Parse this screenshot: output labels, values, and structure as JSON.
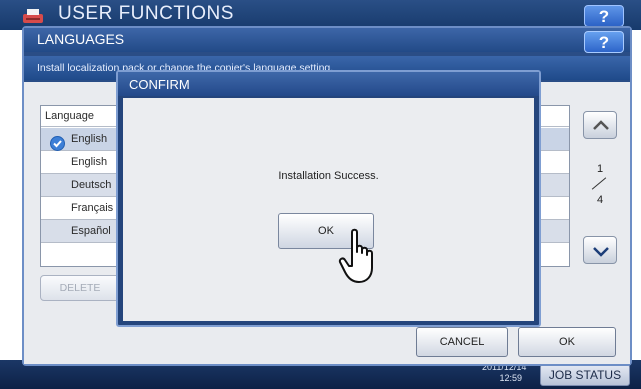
{
  "app": {
    "title": "USER FUNCTIONS",
    "help_label": "?"
  },
  "status_bar": {
    "date": "2011/12/14",
    "time": "12:59",
    "job_status_label": "JOB STATUS"
  },
  "languages_dialog": {
    "title": "LANGUAGES",
    "help_label": "?",
    "description": "Install localization pack or change the copier's language setting.",
    "list_header": "Language",
    "items": [
      {
        "label": "English",
        "selected": true
      },
      {
        "label": "English"
      },
      {
        "label": "Deutsch"
      },
      {
        "label": "Français"
      },
      {
        "label": "Español"
      }
    ],
    "page_current": "1",
    "page_total": "4",
    "delete_label": "DELETE",
    "cancel_label": "CANCEL",
    "ok_label": "OK"
  },
  "confirm_dialog": {
    "title": "CONFIRM",
    "message": "Installation Success.",
    "ok_label": "OK"
  },
  "icons": {
    "app": "printer-icon",
    "selected": "check-circle-icon",
    "up": "chevron-up-icon",
    "down": "chevron-down-icon",
    "pointer": "hand-pointer-icon"
  },
  "colors": {
    "titlebar": "#23498a",
    "dialog_body": "#ebedf0",
    "selected_check": "#3d7fd6"
  }
}
